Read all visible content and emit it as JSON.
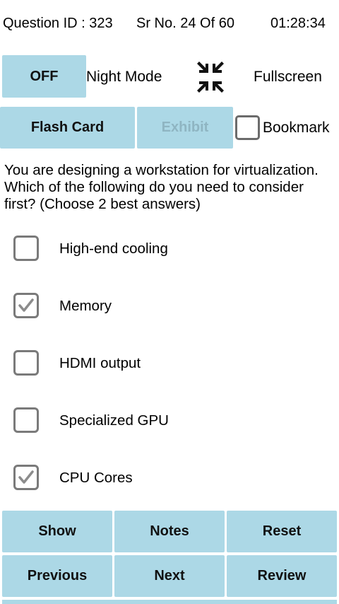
{
  "header": {
    "question_id": "Question ID : 323",
    "sr_no": "Sr No. 24 Of 60",
    "timer": "01:28:34"
  },
  "controls": {
    "night_mode_button": "OFF",
    "night_mode_label": "Night Mode",
    "fullscreen_label": "Fullscreen",
    "flash_card_button": "Flash Card",
    "exhibit_button": "Exhibit",
    "bookmark_label": "Bookmark",
    "bookmark_checked": false
  },
  "question": {
    "text": "You are designing a workstation for virtualization. Which of the following do you need to consider first? (Choose 2 best answers)"
  },
  "options": [
    {
      "label": "High-end cooling",
      "checked": false
    },
    {
      "label": "Memory",
      "checked": true
    },
    {
      "label": "HDMI output",
      "checked": false
    },
    {
      "label": "Specialized GPU",
      "checked": false
    },
    {
      "label": "CPU Cores",
      "checked": true
    }
  ],
  "actions": {
    "show": "Show",
    "notes": "Notes",
    "reset": "Reset",
    "previous": "Previous",
    "next": "Next",
    "review": "Review"
  },
  "colors": {
    "button_bg": "#acd8e6",
    "checkbox_border": "#7a7a7a",
    "checkmark": "#8c8c8c"
  },
  "icons": {
    "fullscreen": "fullscreen-exit-icon",
    "checkmark": "check-icon"
  }
}
